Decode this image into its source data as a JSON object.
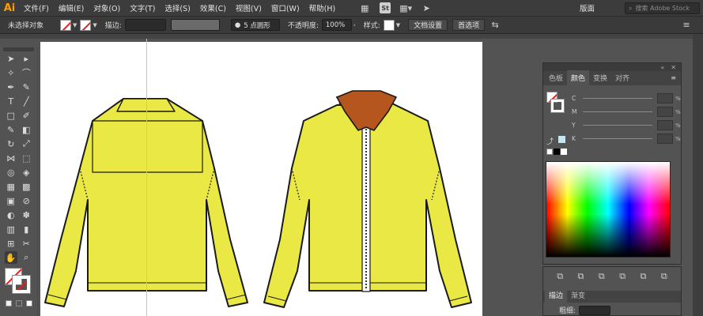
{
  "app": {
    "logo": "Ai",
    "workspace": "版面",
    "search_placeholder": "搜索 Adobe Stock"
  },
  "menu": [
    "文件(F)",
    "编辑(E)",
    "对象(O)",
    "文字(T)",
    "选择(S)",
    "效果(C)",
    "视图(V)",
    "窗口(W)",
    "帮助(H)"
  ],
  "control": {
    "selection": "未选择对象",
    "stroke_label": "描边:",
    "brush": "5 点圆形",
    "opacity_label": "不透明度:",
    "opacity": "100%",
    "style_label": "样式:",
    "doc_setup": "文档设置",
    "prefs": "首选项"
  },
  "color_panel": {
    "tabs": [
      "色板",
      "颜色",
      "变换",
      "对齐"
    ],
    "active_tab": "颜色",
    "channels": [
      "C",
      "M",
      "Y",
      "K"
    ],
    "unit": "%"
  },
  "stroke_panel": {
    "tabs": [
      "描边",
      "渐变"
    ],
    "weight_label": "粗细:"
  },
  "artwork": {
    "jacket_fill": "#eae845",
    "collar_color": "#b5561f",
    "collar_inner": "#c6e6ef",
    "outline": "#1a1a1a"
  }
}
